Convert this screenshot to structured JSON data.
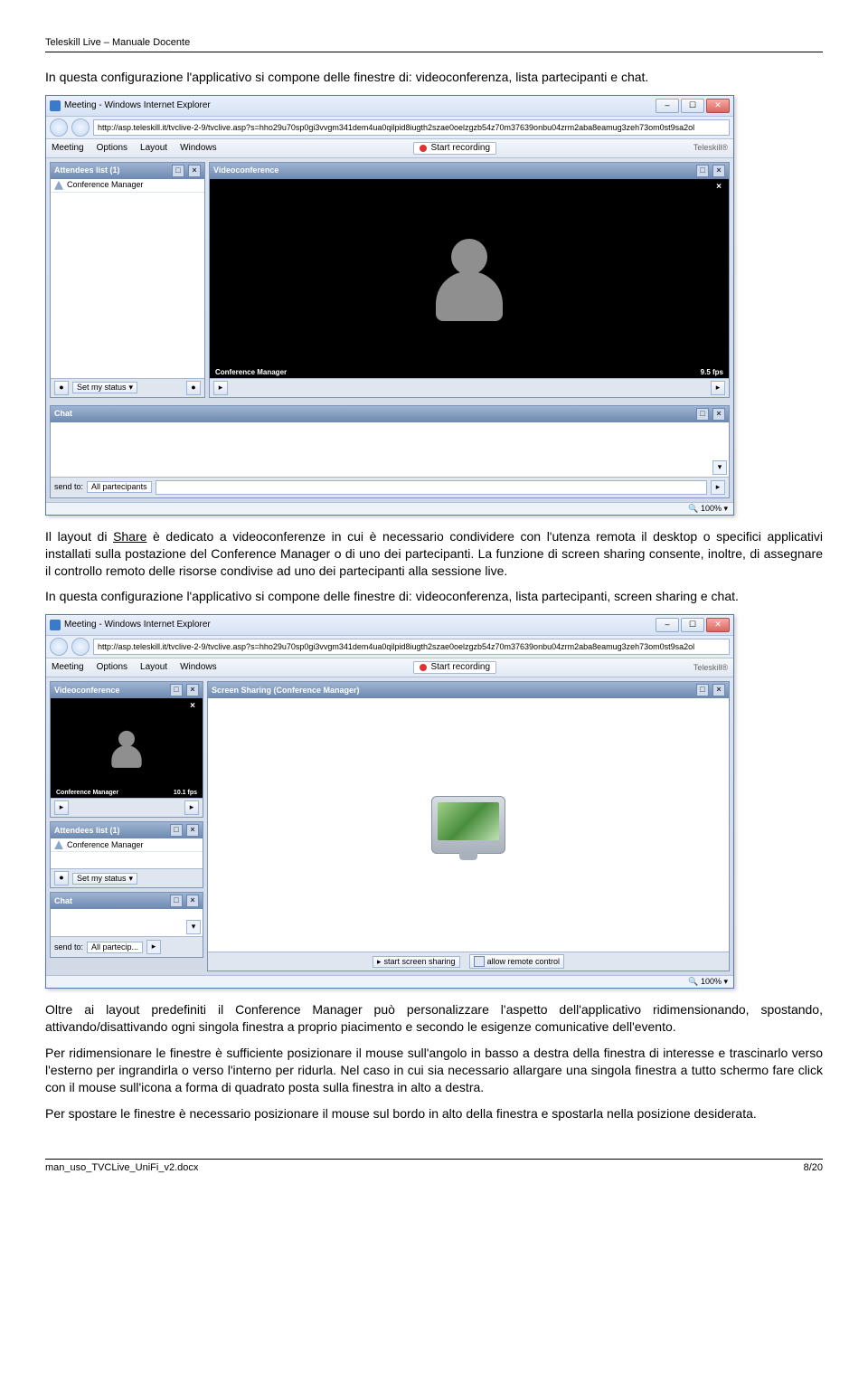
{
  "header": "Teleskill Live – Manuale Docente",
  "para1": "In questa configurazione l'applicativo si compone delle finestre di: videoconferenza, lista partecipanti e chat.",
  "para2_a": "Il layout di ",
  "para2_link": "Share",
  "para2_b": " è dedicato a videoconferenze in cui è necessario condividere con l'utenza remota il desktop o specifici applicativi installati sulla postazione del Conference Manager o di uno dei partecipanti. La funzione di screen sharing consente, inoltre, di assegnare il controllo remoto delle risorse condivise ad uno dei partecipanti alla sessione live.",
  "para3": "In questa configurazione l'applicativo si compone delle finestre di: videoconferenza, lista partecipanti, screen sharing e chat.",
  "para4": "Oltre ai layout predefiniti il Conference Manager può personalizzare l'aspetto dell'applicativo ridimensionando, spostando, attivando/disattivando ogni singola finestra a proprio piacimento e secondo le esigenze comunicative dell'evento.",
  "para5": "Per ridimensionare le finestre è sufficiente posizionare il mouse sull'angolo in basso a destra della finestra di interesse e trascinarlo verso l'esterno per ingrandirla o verso l'interno per ridurla. Nel caso in cui sia necessario allargare una singola finestra a tutto schermo fare click con il mouse sull'icona a forma di quadrato posta sulla finestra in alto a destra.",
  "para6": "Per spostare le finestre è necessario posizionare il mouse sul bordo in alto della finestra e spostarla nella posizione desiderata.",
  "footer_file": "man_uso_TVCLive_UniFi_v2.docx",
  "footer_page": "8/20",
  "shot1": {
    "window_title": "Meeting - Windows Internet Explorer",
    "url": "http://asp.teleskill.it/tvclive-2-9/tvclive.asp?s=hho29u70sp0gi3vvgm341dem4ua0qilpid8iugth2szae0oelzgzb54z70m37639onbu04zrm2aba8eamug3zeh73om0st9sa2ol",
    "menu": {
      "meeting": "Meeting",
      "options": "Options",
      "layout": "Layout",
      "windows": "Windows"
    },
    "rec": "Start recording",
    "brand": "Teleskill®",
    "attendees_title": "Attendees list (1)",
    "attendee": "Conference Manager",
    "videoconf_title": "Videoconference",
    "video_name": "Conference Manager",
    "video_fps": "9.5 fps",
    "chat_title": "Chat",
    "chat_sendto": "send to:",
    "chat_target": "All partecipants",
    "status_btn": "Set my status",
    "zoom": "100%"
  },
  "shot2": {
    "window_title": "Meeting - Windows Internet Explorer",
    "url": "http://asp.teleskill.it/tvclive-2-9/tvclive.asp?s=hho29u70sp0gi3vvgm341dem4ua0qilpid8iugth2szae0oelzgzb54z70m37639onbu04zrm2aba8eamug3zeh73om0st9sa2ol",
    "menu": {
      "meeting": "Meeting",
      "options": "Options",
      "layout": "Layout",
      "windows": "Windows"
    },
    "rec": "Start recording",
    "brand": "Teleskill®",
    "videoconf_title": "Videoconference",
    "video_name": "Conference Manager",
    "video_fps": "10.1 fps",
    "sharing_title": "Screen Sharing (Conference Manager)",
    "attendees_title": "Attendees list (1)",
    "attendee": "Conference Manager",
    "status_btn": "Set my status",
    "chat_title": "Chat",
    "chat_sendto": "send to:",
    "chat_target": "All partecip...",
    "btn_start": "start screen sharing",
    "btn_allow": "allow remote control",
    "zoom": "100%"
  }
}
